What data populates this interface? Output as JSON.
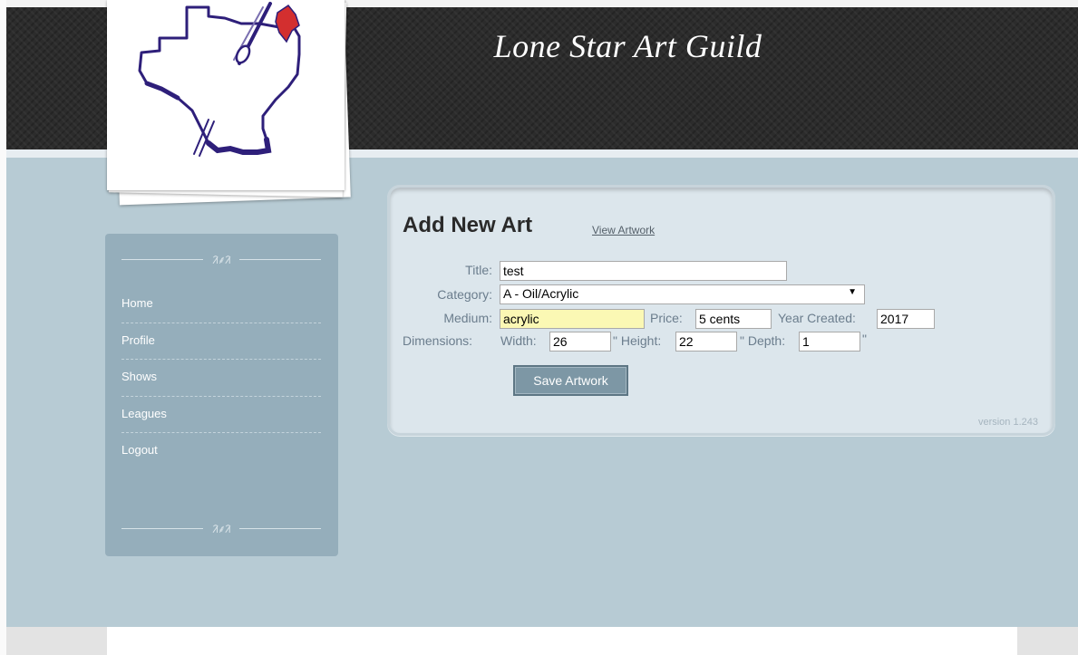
{
  "site": {
    "title": "Lone Star Art Guild"
  },
  "sidebar": {
    "ornament": "ᱤ⸙ᱤ",
    "items": [
      {
        "label": "Home"
      },
      {
        "label": "Profile"
      },
      {
        "label": "Shows"
      },
      {
        "label": "Leagues"
      },
      {
        "label": "Logout"
      }
    ]
  },
  "content": {
    "title": "Add New Art",
    "view_link": "View Artwork",
    "form": {
      "title_label": "Title:",
      "title_value": "test",
      "category_label": "Category:",
      "category_value": "A - Oil/Acrylic",
      "medium_label": "Medium:",
      "medium_value": "acrylic",
      "price_label": "Price:",
      "price_value": "5 cents",
      "year_label": "Year Created:",
      "year_value": "2017",
      "dimensions_label": "Dimensions:",
      "width_label": "Width:",
      "width_value": "26",
      "height_label": "\" Height:",
      "height_value": "22",
      "depth_label": "\" Depth:",
      "depth_value": "1",
      "inch_mark": "\"",
      "save_label": "Save Artwork"
    },
    "version": "version 1.243"
  },
  "colors": {
    "header_bg": "#2c2c2c",
    "main_bg": "#b7cbd4",
    "sidebar_bg": "#95aebb",
    "panel_bg": "#dce6ec",
    "label_color": "#6b7d8d",
    "highlight_field": "#fbf8b4",
    "button_bg": "#7d97a5",
    "logo_outline": "#2e1f7a",
    "logo_flag_red": "#d32f2f"
  },
  "icons": {
    "logo": "texas-map-paintbrush-logo",
    "select_arrow": "chevron-down-icon"
  }
}
